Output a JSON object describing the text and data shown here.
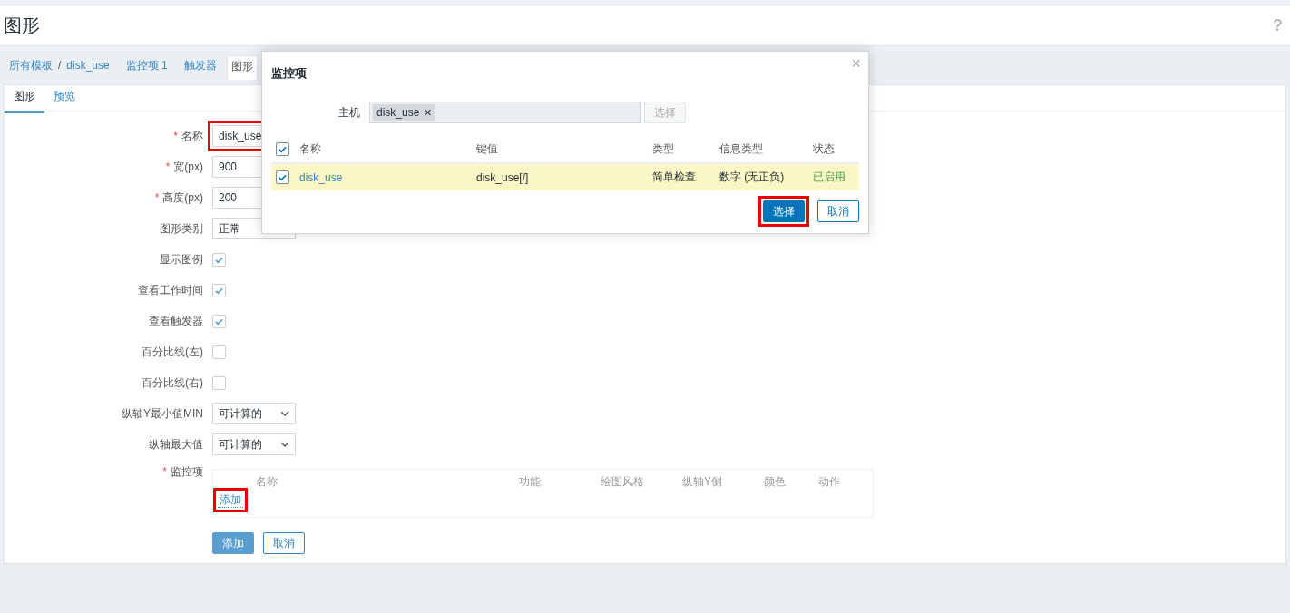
{
  "header": {
    "title": "图形",
    "help": "?"
  },
  "breadcrumbs": [
    {
      "label": "所有模板",
      "kind": "link"
    },
    {
      "label": "/",
      "kind": "separator"
    },
    {
      "label": "disk_use",
      "kind": "link"
    },
    {
      "label": "监控项 1",
      "kind": "link"
    },
    {
      "label": "触发器",
      "kind": "link"
    },
    {
      "label": "图形",
      "kind": "current"
    }
  ],
  "tabs": [
    {
      "label": "图形",
      "selected": true
    },
    {
      "label": "预览",
      "selected": false
    }
  ],
  "form": {
    "fields": [
      {
        "label": "名称",
        "required_mark": "*",
        "kind": "input",
        "value": "disk_use",
        "highlighted": true
      },
      {
        "label": "宽(px)",
        "required_mark": "*",
        "kind": "input",
        "value": "900"
      },
      {
        "label": "高度(px)",
        "required_mark": "*",
        "kind": "input",
        "value": "200"
      },
      {
        "label": "图形类别",
        "kind": "select",
        "value": "正常"
      },
      {
        "label": "显示图例",
        "kind": "checkbox",
        "checked": true
      },
      {
        "label": "查看工作时间",
        "kind": "checkbox",
        "checked": true
      },
      {
        "label": "查看触发器",
        "kind": "checkbox",
        "checked": true
      },
      {
        "label": "百分比线(左)",
        "kind": "checkbox",
        "checked": false
      },
      {
        "label": "百分比线(右)",
        "kind": "checkbox",
        "checked": false
      },
      {
        "label": "纵轴Y最小值MIN",
        "kind": "select",
        "value": "可计算的"
      },
      {
        "label": "纵轴最大值",
        "kind": "select",
        "value": "可计算的"
      }
    ],
    "items": {
      "label": "监控项",
      "required_mark": "*",
      "columns": [
        "名称",
        "功能",
        "绘图风格",
        "纵轴Y侧",
        "颜色",
        "动作"
      ],
      "add_link": {
        "label": "添加",
        "highlighted": true
      }
    },
    "buttons": [
      {
        "label": "添加",
        "kind": "primary"
      },
      {
        "label": "取消",
        "kind": "secondary"
      }
    ]
  },
  "modal": {
    "title": "监控项",
    "close": "×",
    "host_label": "主机",
    "host_chip": {
      "label": "disk_use",
      "remove": "✕"
    },
    "host_select": {
      "label": "选择",
      "disabled": true
    },
    "columns": [
      "名称",
      "键值",
      "类型",
      "信息类型",
      "状态"
    ],
    "select_all": true,
    "rows": [
      {
        "name": "disk_use",
        "key": "disk_use[/]",
        "type": "简单检查",
        "info_type": "数字 (无正负)",
        "status": "已启用",
        "checked": true,
        "selected": true
      }
    ],
    "buttons": [
      {
        "label": "选择",
        "kind": "primary",
        "highlighted": true
      },
      {
        "label": "取消",
        "kind": "secondary"
      }
    ]
  }
}
